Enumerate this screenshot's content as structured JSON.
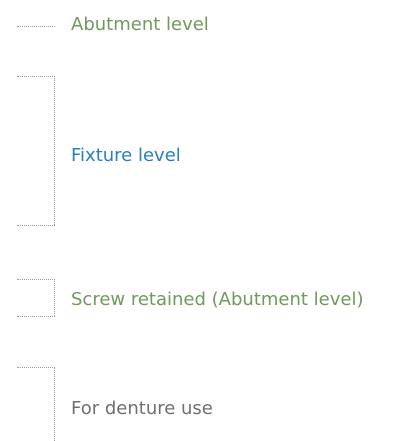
{
  "items": [
    {
      "label": "Abutment level",
      "color": "#6f9a5e"
    },
    {
      "label": "Fixture level",
      "color": "#2a7fc2"
    },
    {
      "label": "Screw retained (Abutment level)",
      "color": "#6f9a5e"
    },
    {
      "label": "For denture use",
      "color": "#6f6f6f"
    }
  ]
}
